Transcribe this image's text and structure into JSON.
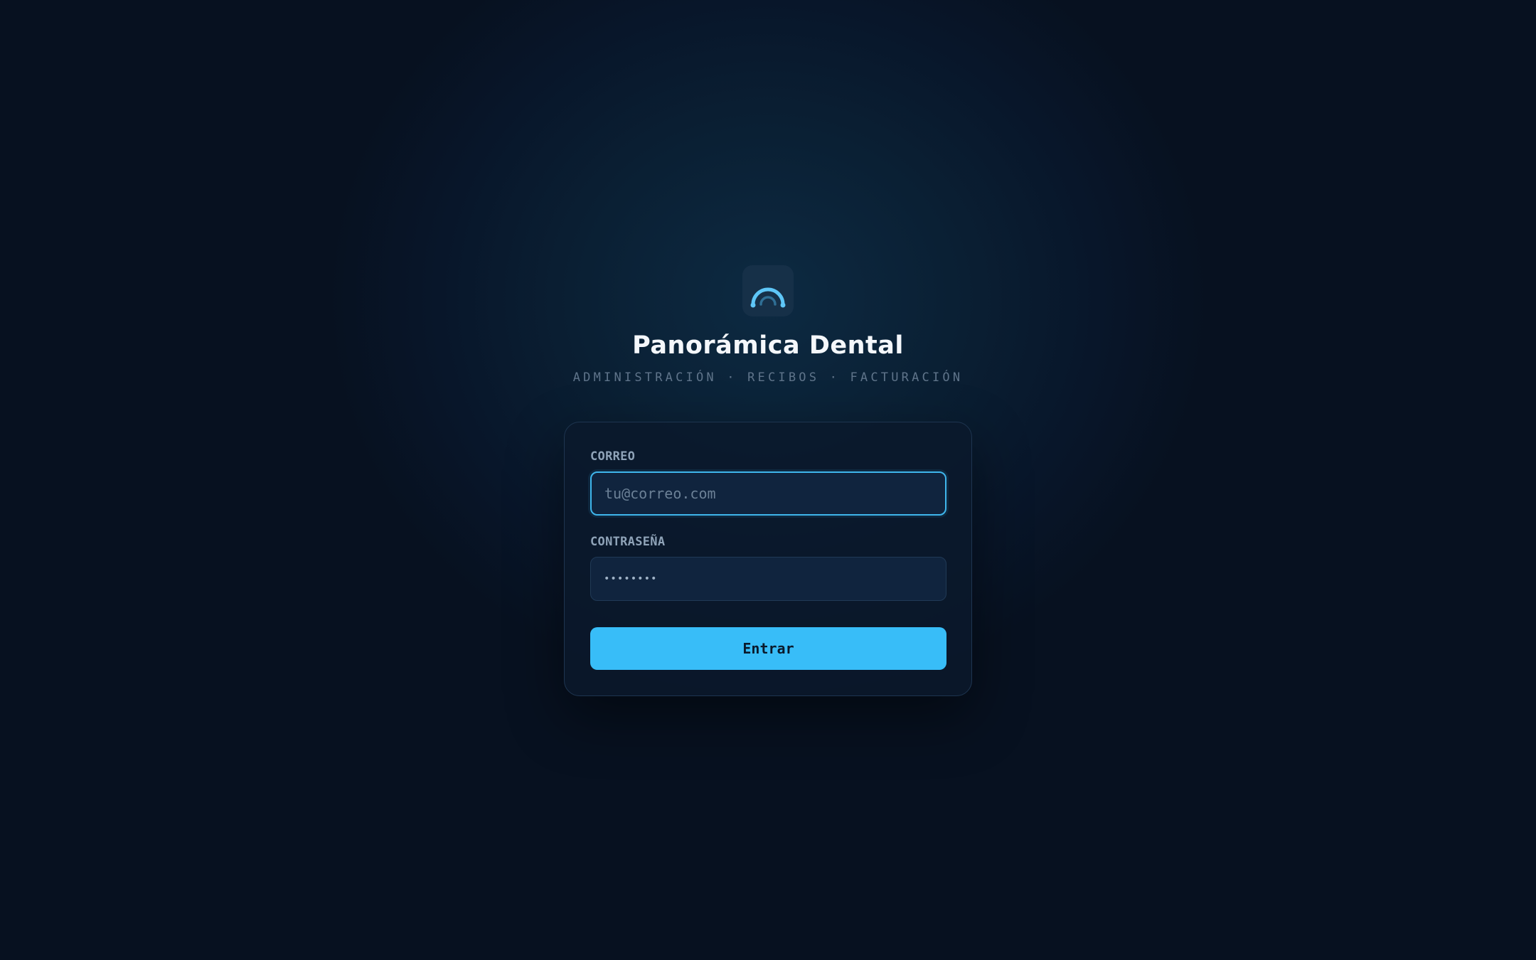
{
  "app": {
    "title": "Panorámica Dental",
    "subtitle": "ADMINISTRACIÓN · RECIBOS · FACTURACIÓN",
    "logo_icon": "arch-icon"
  },
  "login": {
    "email_label": "CORREO",
    "email_placeholder": "tu@correo.com",
    "email_value": "",
    "password_label": "CONTRASEÑA",
    "password_value": "••••••••",
    "submit_label": "Entrar"
  },
  "colors": {
    "accent": "#38bdf8",
    "background": "#071120",
    "card": "#0a192c",
    "input": "#10243e"
  }
}
